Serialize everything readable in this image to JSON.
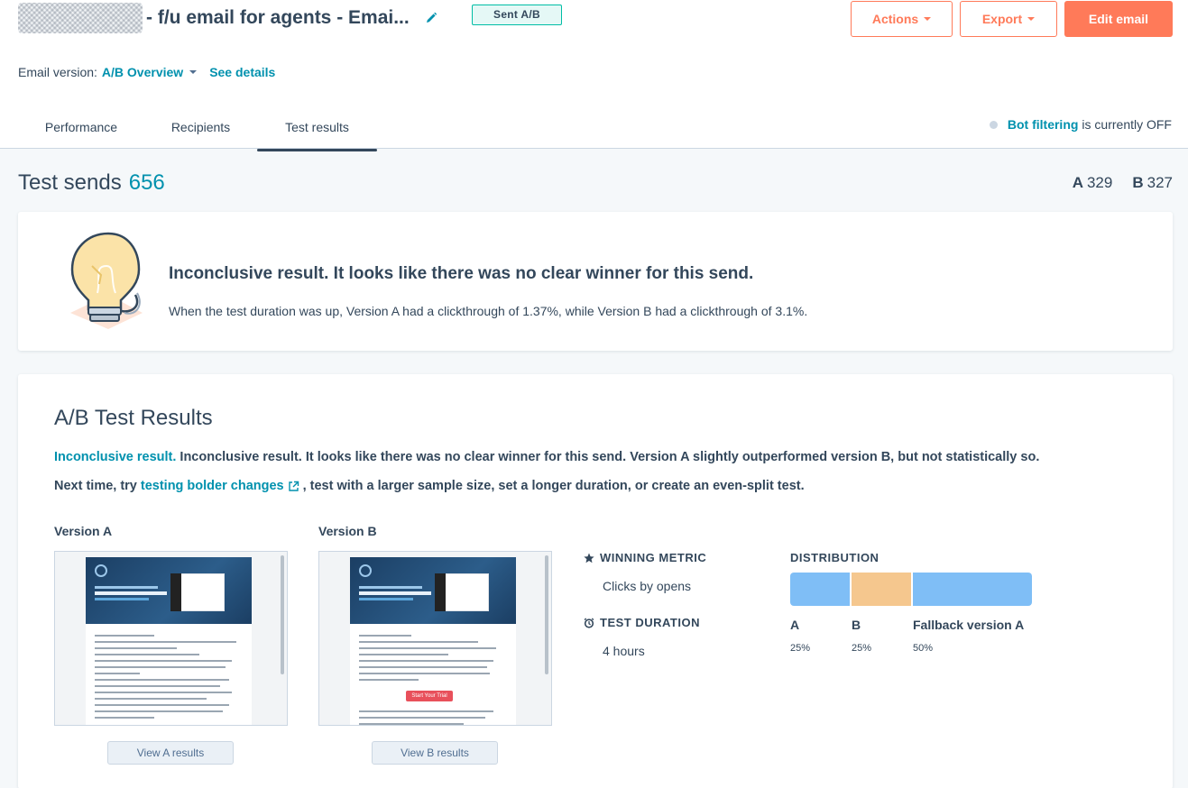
{
  "header": {
    "title": "- f/u email for agents - Emai...",
    "status_badge": "Sent A/B",
    "actions_label": "Actions",
    "export_label": "Export",
    "edit_label": "Edit email"
  },
  "version_bar": {
    "label": "Email version:",
    "value": "A/B Overview",
    "details_link": "See details"
  },
  "tabs": [
    {
      "label": "Performance",
      "active": false
    },
    {
      "label": "Recipients",
      "active": false
    },
    {
      "label": "Test results",
      "active": true
    }
  ],
  "bot_filter": {
    "link": "Bot filtering",
    "status": "is currently OFF"
  },
  "test_sends": {
    "label": "Test sends",
    "count": "656",
    "a_label": "A",
    "a_count": "329",
    "b_label": "B",
    "b_count": "327"
  },
  "summary": {
    "heading": "Inconclusive result. It looks like there was no clear winner for this send.",
    "text": "When the test duration was up, Version A had a clickthrough of 1.37%, while Version B had a clickthrough of 3.1%."
  },
  "ab_results": {
    "title": "A/B Test Results",
    "line1_highlight": "Inconclusive result.",
    "line1_rest": "Inconclusive result. It looks like there was no clear winner for this send. Version A slightly outperformed version B, but not statistically so.",
    "line2_prefix": "Next time, try",
    "line2_link": "testing bolder changes",
    "line2_suffix": ", test with a larger sample size, set a longer duration, or create an even-split test.",
    "version_a_label": "Version A",
    "version_b_label": "Version B",
    "view_a_button": "View A results",
    "view_b_button": "View B results",
    "preview_b_button": "Start Your Trial",
    "winning_metric_label": "WINNING METRIC",
    "winning_metric_value": "Clicks by opens",
    "test_duration_label": "TEST DURATION",
    "test_duration_value": "4 hours",
    "distribution_label": "DISTRIBUTION",
    "distribution": [
      {
        "name": "A",
        "percent": "25%",
        "value": 25,
        "color": "#7fbef6"
      },
      {
        "name": "B",
        "percent": "25%",
        "value": 25,
        "color": "#f5c78e"
      },
      {
        "name": "Fallback version A",
        "percent": "50%",
        "value": 50,
        "color": "#7fbef6"
      }
    ]
  },
  "colors": {
    "accent": "#ff7a59",
    "link": "#0091ae",
    "text": "#33475b",
    "badge_border": "#00bda5"
  }
}
